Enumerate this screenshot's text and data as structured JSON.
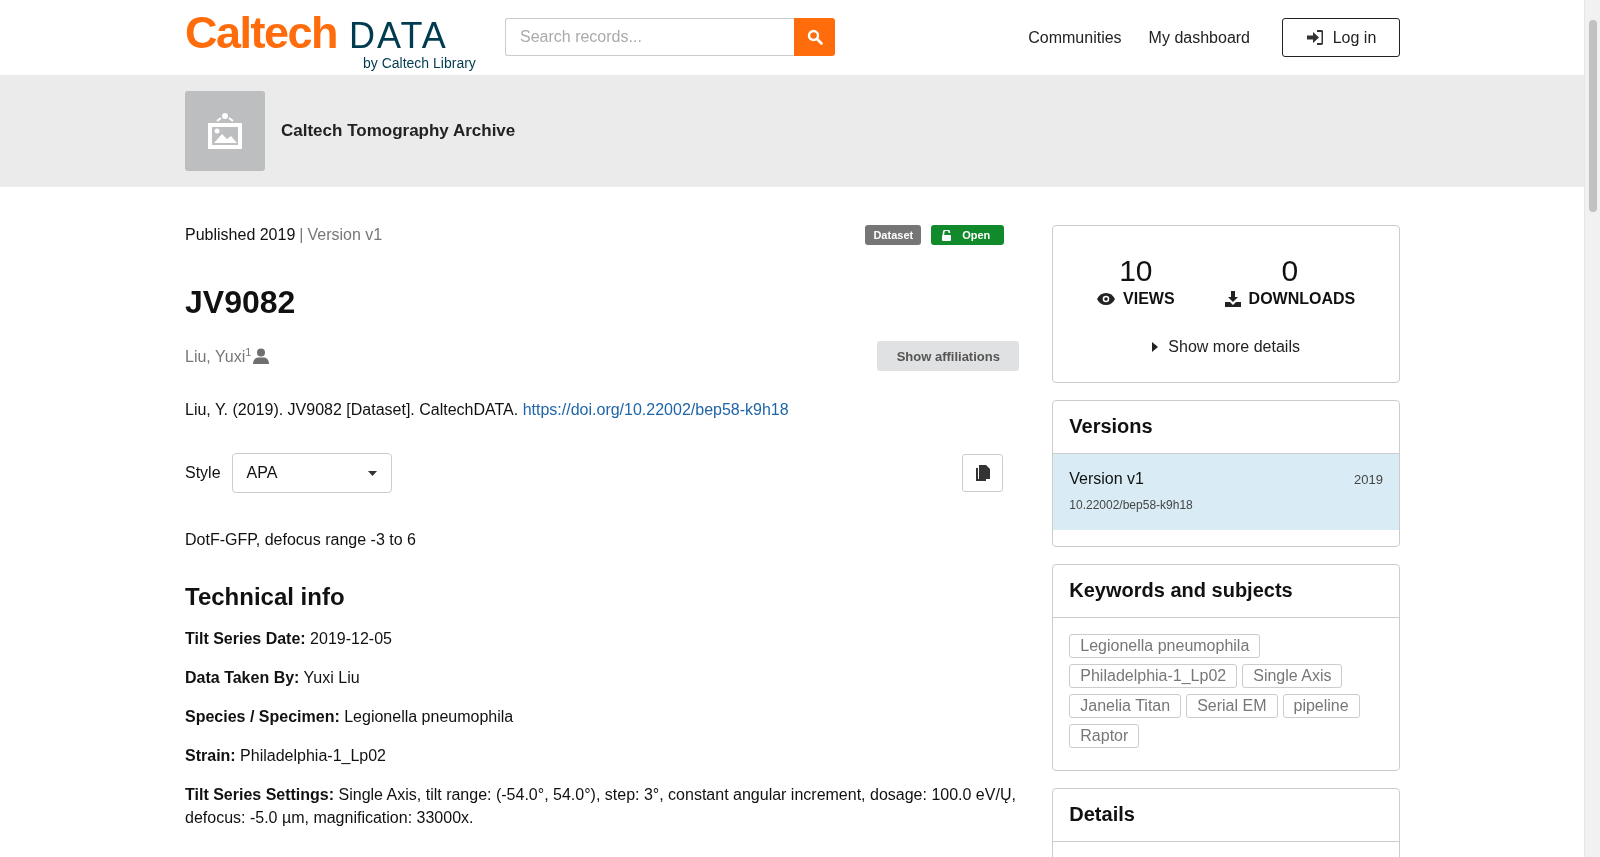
{
  "header": {
    "logo": {
      "wordmark": "Caltech",
      "product": "DATA",
      "tagline": "by Caltech Library"
    },
    "search": {
      "placeholder": "Search records..."
    },
    "nav": [
      "Communities",
      "My dashboard"
    ],
    "login_button": "Log in"
  },
  "community": {
    "name": "Caltech Tomography Archive"
  },
  "record": {
    "published": "Published 2019",
    "separator": "|",
    "version": "Version v1",
    "badges": [
      {
        "label": "Dataset",
        "kind": "type"
      },
      {
        "label": "Open",
        "kind": "access"
      }
    ],
    "title": "JV9082",
    "creators": [
      {
        "name": "Liu, Yuxi",
        "affiliation_mark": "1"
      }
    ],
    "affiliations_button": "Show affiliations",
    "citation": {
      "text": "Liu, Y. (2019). JV9082 [Dataset]. CaltechDATA.",
      "link": "https://doi.org/10.22002/bep58-k9h18"
    },
    "style": {
      "label": "Style",
      "value": "APA"
    },
    "description": "DotF-GFP, defocus range -3 to 6",
    "technical_info": {
      "heading": "Technical info",
      "fields": [
        {
          "label": "Tilt Series Date:",
          "value": "2019-12-05"
        },
        {
          "label": "Data Taken By:",
          "value": "Yuxi Liu"
        },
        {
          "label": "Species / Specimen:",
          "value": "Legionella pneumophila"
        },
        {
          "label": "Strain:",
          "value": "Philadelphia-1_Lp02"
        },
        {
          "label": "Tilt Series Settings:",
          "value": "Single Axis, tilt range: (-54.0°, 54.0°), step: 3°, constant angular increment, dosage: 100.0 eV/Ų, defocus: -5.0 µm, magnification: 33000x."
        }
      ]
    }
  },
  "stats": {
    "views": {
      "count": "10",
      "label": "VIEWS"
    },
    "downloads": {
      "count": "0",
      "label": "DOWNLOADS"
    },
    "more": "Show more details"
  },
  "versions": {
    "heading": "Versions",
    "items": [
      {
        "label": "Version v1",
        "year": "2019",
        "doi": "10.22002/bep58-k9h18",
        "selected": true
      }
    ]
  },
  "keywords": {
    "heading": "Keywords and subjects",
    "tags": [
      "Legionella pneumophila",
      "Philadelphia-1_Lp02",
      "Single Axis",
      "Janelia Titan",
      "Serial EM",
      "pipeline",
      "Raptor"
    ]
  },
  "details": {
    "heading": "Details"
  }
}
